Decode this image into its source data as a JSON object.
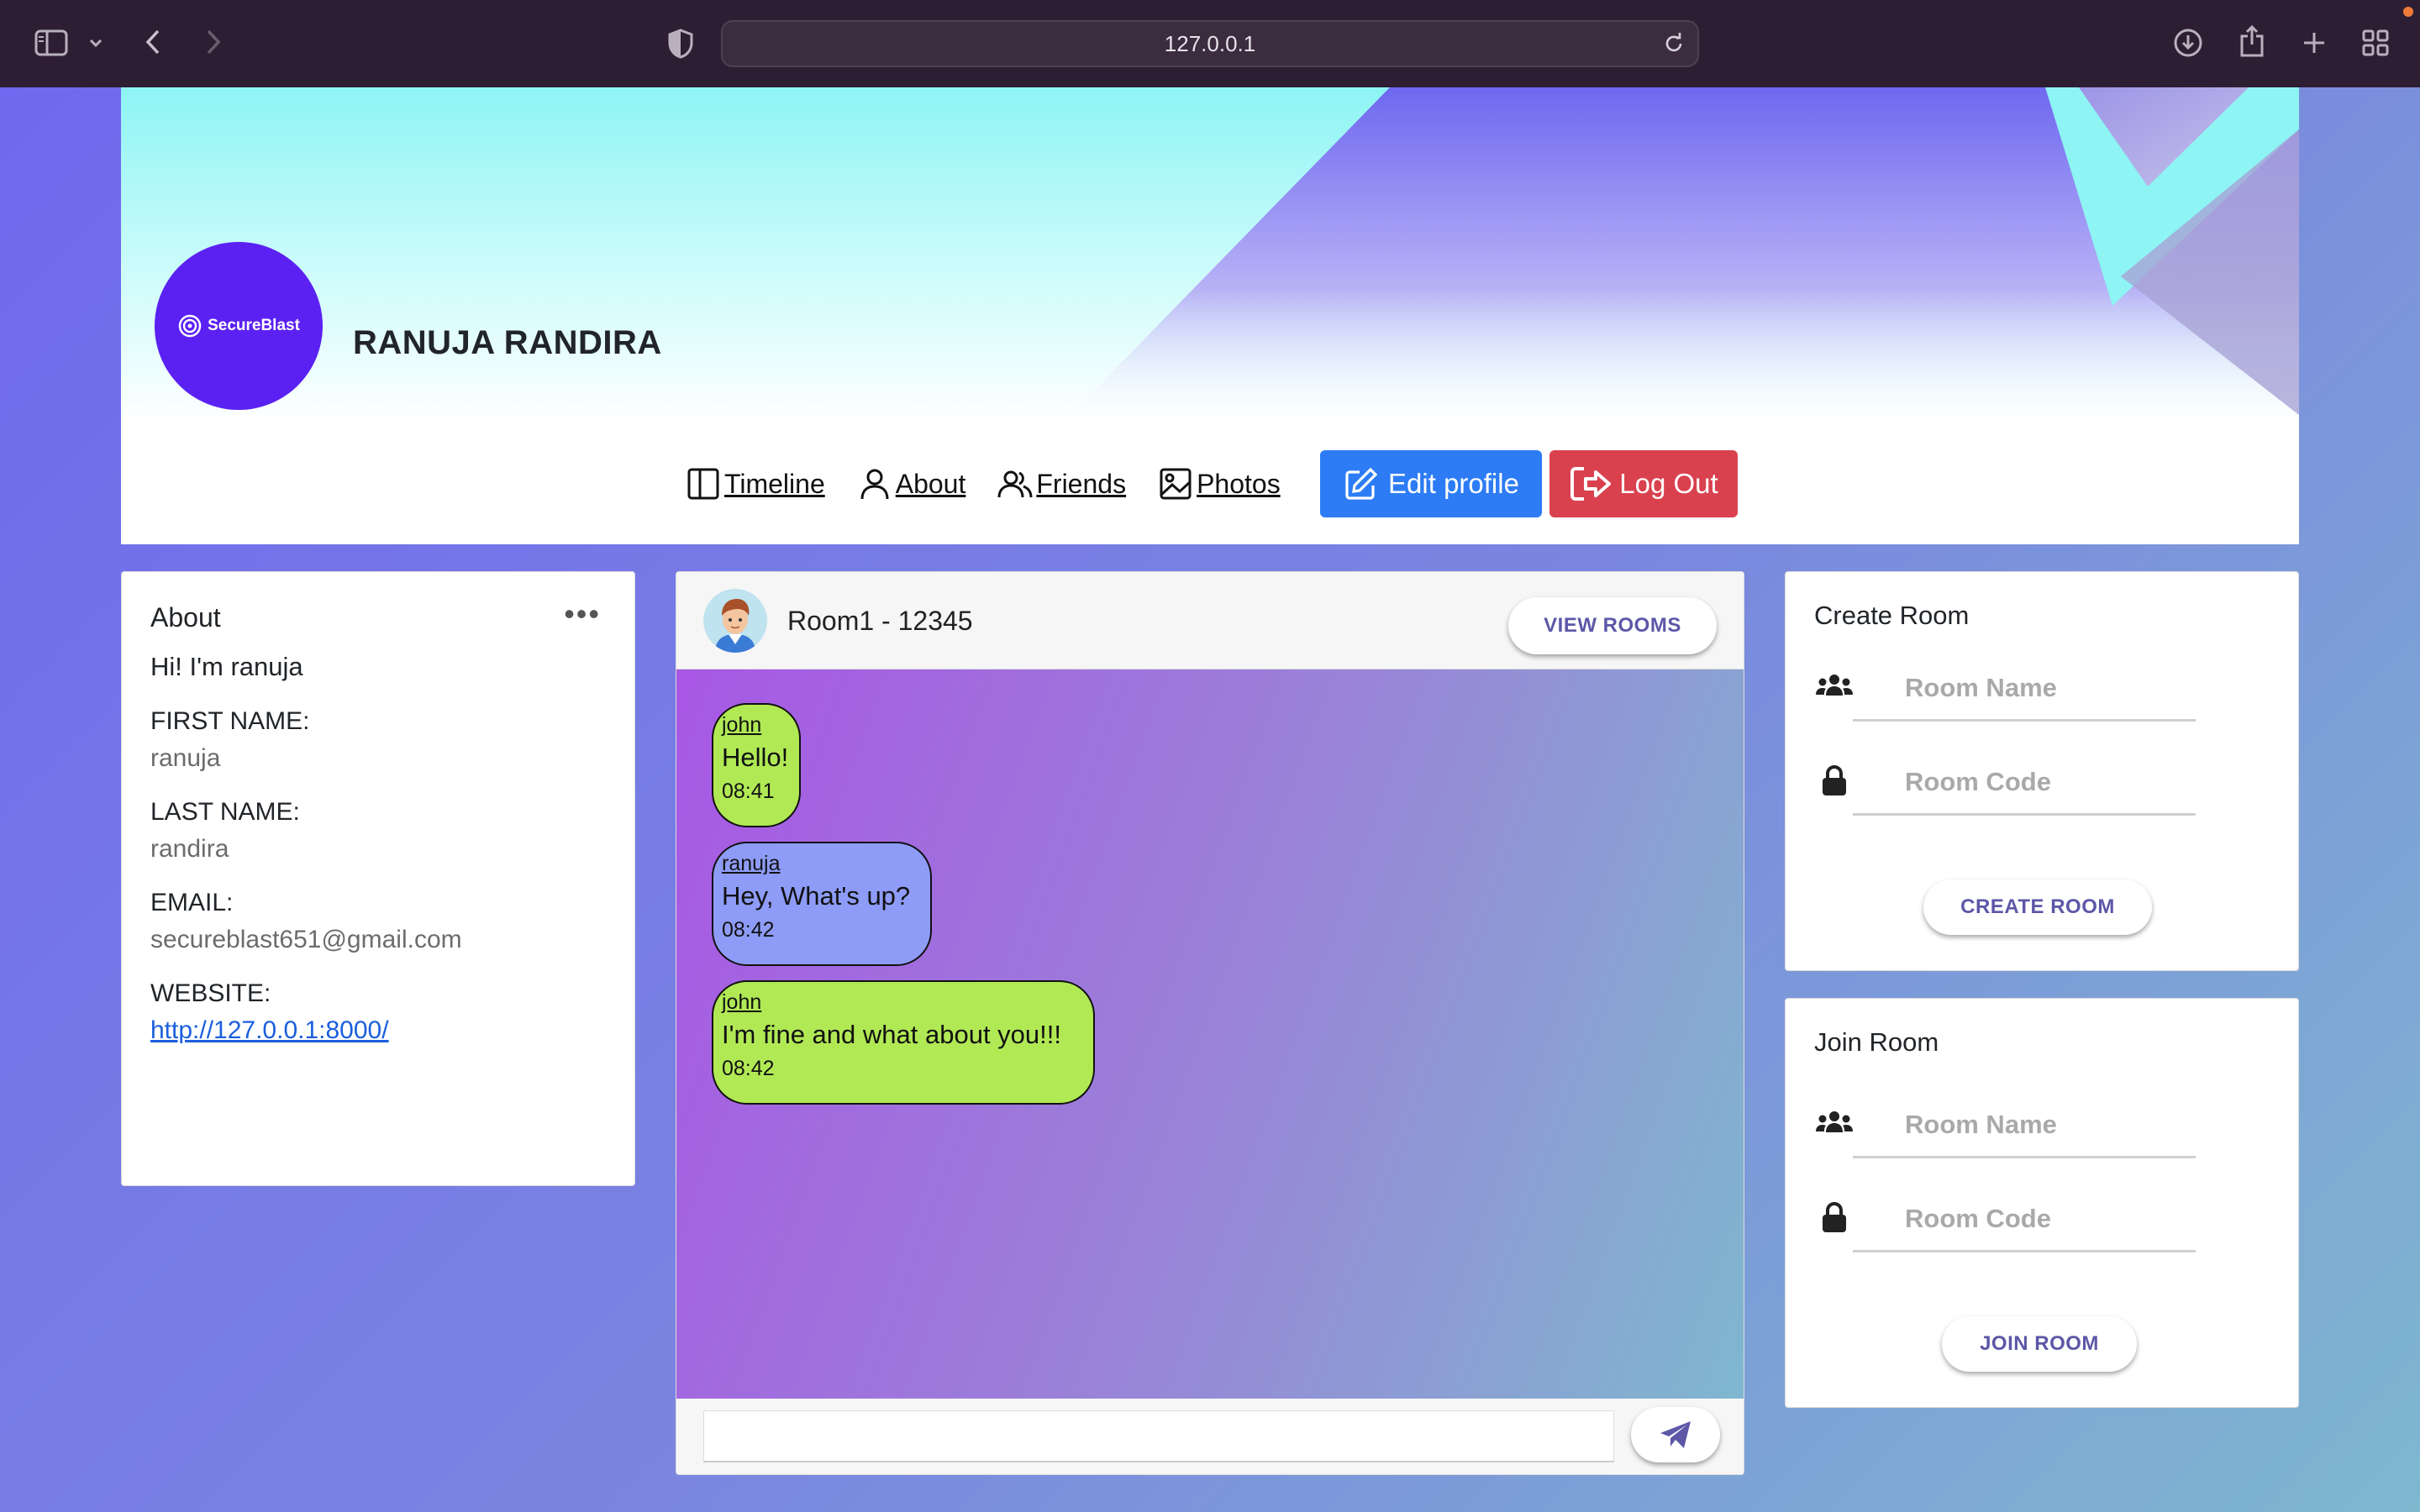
{
  "browser": {
    "url": "127.0.0.1"
  },
  "profile": {
    "logo_text": "SecureBlast",
    "name": "RANUJA RANDIRA"
  },
  "nav": {
    "timeline": "Timeline",
    "about": "About",
    "friends": "Friends",
    "photos": "Photos",
    "edit_profile": "Edit profile",
    "log_out": "Log Out"
  },
  "about": {
    "title": "About",
    "bio": "Hi! I'm ranuja",
    "first_name_label": "FIRST NAME:",
    "first_name": "ranuja",
    "last_name_label": "LAST NAME:",
    "last_name": "randira",
    "email_label": "EMAIL:",
    "email": "secureblast651@gmail.com",
    "website_label": "WEBSITE:",
    "website": "http://127.0.0.1:8000/"
  },
  "chat": {
    "room_title": "Room1 - 12345",
    "view_rooms": "VIEW ROOMS",
    "messages": [
      {
        "user": "john",
        "text": "Hello!",
        "time": "08:41",
        "color": "#b1e955"
      },
      {
        "user": "ranuja",
        "text": "Hey, What's up?",
        "time": "08:42",
        "color": "#8e9cf7"
      },
      {
        "user": "john",
        "text": "I'm fine and what about you!!!",
        "time": "08:42",
        "color": "#b1e955"
      }
    ],
    "input_placeholder": ""
  },
  "create_room": {
    "title": "Create Room",
    "room_name_placeholder": "Room Name",
    "room_code_placeholder": "Room Code",
    "button": "CREATE ROOM"
  },
  "join_room": {
    "title": "Join Room",
    "room_name_placeholder": "Room Name",
    "room_code_placeholder": "Room Code",
    "button": "JOIN ROOM"
  },
  "colors": {
    "edit_button": "#2d7cf5",
    "logout_button": "#d9414e",
    "avatar_bg": "#5b21f2",
    "pill_text": "#5d57a8"
  }
}
